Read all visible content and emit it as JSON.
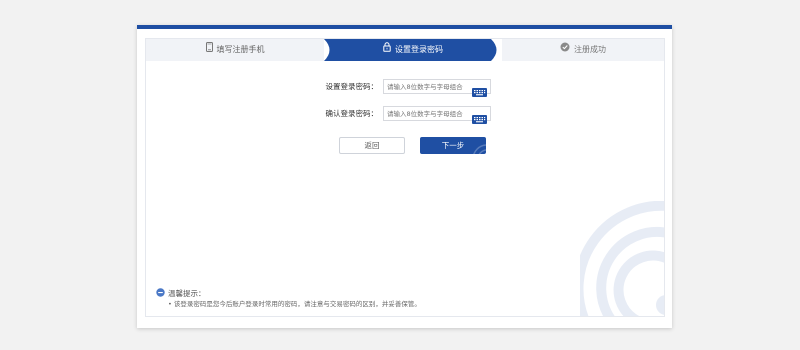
{
  "steps": [
    {
      "label": "填写注册手机",
      "icon": "phone-icon",
      "state": "done"
    },
    {
      "label": "设置登录密码",
      "icon": "lock-icon",
      "state": "active"
    },
    {
      "label": "注册成功",
      "icon": "check-circle-icon",
      "state": "pending"
    }
  ],
  "form": {
    "password_label": "设置登录密码：",
    "password_placeholder": "请输入8位数字与字母组合",
    "confirm_label": "确认登录密码：",
    "confirm_placeholder": "请输入8位数字与字母组合",
    "keyboard_icon": "keyboard-icon"
  },
  "buttons": {
    "back_label": "返回",
    "next_label": "下一步"
  },
  "tips": {
    "title": "温馨提示：",
    "lines": [
      "• 该登录密码是您今后账户登录时常用的密码，请注意与交易密码的区别，并妥善保管。"
    ]
  },
  "colors": {
    "brand": "#1f4fa3",
    "step_inactive_bg": "#f1f3f7",
    "page_bg": "#f2f2f2"
  }
}
